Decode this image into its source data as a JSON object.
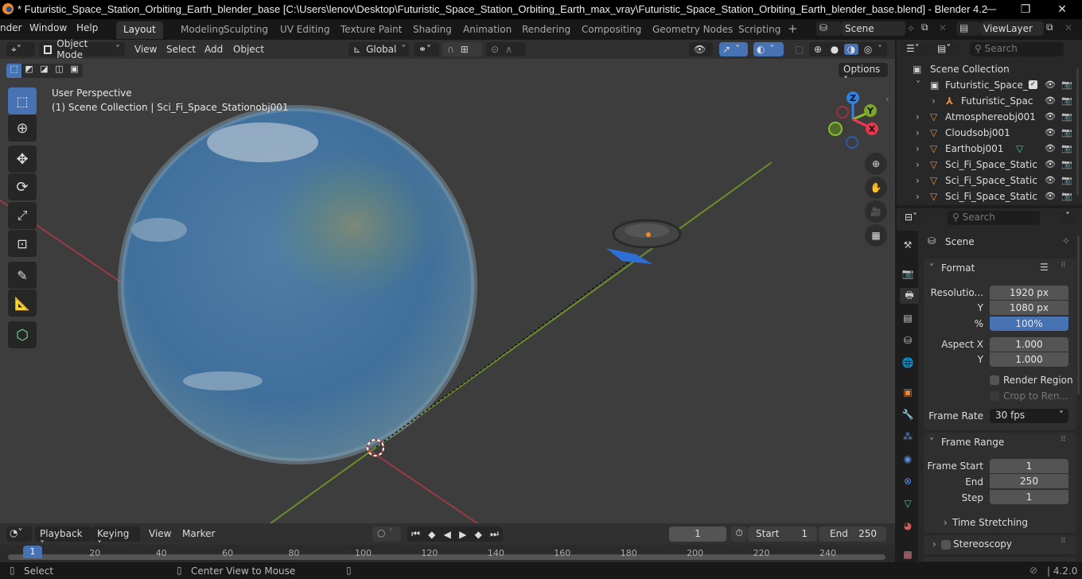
{
  "window": {
    "title": "* Futuristic_Space_Station_Orbiting_Earth_blender_base [C:\\Users\\lenov\\Desktop\\Futuristic_Space_Station_Orbiting_Earth_max_vray\\Futuristic_Space_Station_Orbiting_Earth_blender_base.blend] - Blender 4.2",
    "controls": {
      "minimize": "—",
      "maximize": "❐",
      "close": "✕"
    }
  },
  "menubar": {
    "menus": [
      "nder",
      "Window",
      "Help"
    ],
    "workspaces": [
      {
        "label": "Layout",
        "active": true
      },
      {
        "label": "Modeling"
      },
      {
        "label": "Sculpting"
      },
      {
        "label": "UV Editing"
      },
      {
        "label": "Texture Paint"
      },
      {
        "label": "Shading"
      },
      {
        "label": "Animation"
      },
      {
        "label": "Rendering"
      },
      {
        "label": "Compositing"
      },
      {
        "label": "Geometry Nodes"
      },
      {
        "label": "Scripting"
      }
    ],
    "add_workspace": "+",
    "scene": "Scene",
    "view_layer": "ViewLayer"
  },
  "viewport_header": {
    "mode": "Object Mode",
    "menus": [
      "View",
      "Select",
      "Add",
      "Object"
    ],
    "orientation": "Global",
    "options": "Options"
  },
  "viewport": {
    "perspective": "User Perspective",
    "collection_info": "(1) Scene Collection | Sci_Fi_Space_Stationobj001",
    "gizmo": {
      "x": "X",
      "y": "Y",
      "z": "Z"
    },
    "colors": {
      "x": "#f0394f",
      "y": "#8bbf2b",
      "z": "#2f82e3",
      "accent": "#4772b3"
    }
  },
  "outliner": {
    "search_placeholder": "Search",
    "root": "Scene Collection",
    "items": [
      {
        "label": "Futuristic_Space_S",
        "type": "collection",
        "indent": 1
      },
      {
        "label": "Futuristic_Spac",
        "type": "armature",
        "indent": 2
      },
      {
        "label": "Atmosphereobj001",
        "type": "mesh",
        "indent": 1
      },
      {
        "label": "Cloudsobj001",
        "type": "mesh",
        "indent": 1
      },
      {
        "label": "Earthobj001",
        "type": "mesh",
        "indent": 1
      },
      {
        "label": "Sci_Fi_Space_Static",
        "type": "mesh",
        "indent": 1
      },
      {
        "label": "Sci_Fi_Space_Static",
        "type": "mesh",
        "indent": 1
      },
      {
        "label": "Sci_Fi_Space_Static",
        "type": "mesh",
        "indent": 1
      }
    ]
  },
  "properties": {
    "search_placeholder": "Search",
    "context": "Scene",
    "format": {
      "title": "Format",
      "resolution_label": "Resolutio...",
      "resolution_x": "1920 px",
      "y_label": "Y",
      "resolution_y": "1080 px",
      "percent_label": "%",
      "percent": "100%",
      "aspect_x_label": "Aspect X",
      "aspect_x": "1.000",
      "aspect_y_label": "Y",
      "aspect_y": "1.000",
      "render_region": "Render Region",
      "crop": "Crop to Ren...",
      "frame_rate_label": "Frame Rate",
      "frame_rate": "30 fps"
    },
    "frame_range": {
      "title": "Frame Range",
      "start_label": "Frame Start",
      "start": "1",
      "end_label": "End",
      "end": "250",
      "step_label": "Step",
      "step": "1",
      "time_stretching": "Time Stretching"
    },
    "stereoscopy": "Stereoscopy"
  },
  "timeline": {
    "menus": [
      "Playback",
      "Keying",
      "View",
      "Marker"
    ],
    "current_frame": "1",
    "start_label": "Start",
    "start": "1",
    "end_label": "End",
    "end": "250",
    "ticks": [
      "20",
      "40",
      "60",
      "80",
      "100",
      "120",
      "140",
      "160",
      "180",
      "200",
      "220",
      "240"
    ],
    "playhead": "1"
  },
  "statusbar": {
    "select": "Select",
    "center": "Center View to Mouse",
    "version": "4.2.0"
  }
}
